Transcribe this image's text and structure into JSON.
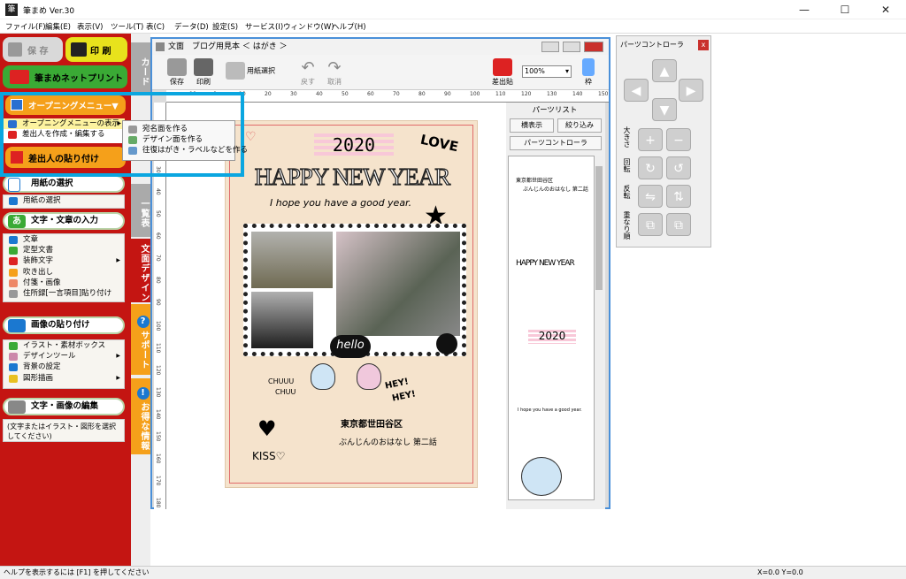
{
  "app": {
    "title": "筆まめ Ver.30",
    "icon": "筆"
  },
  "window_controls": {
    "minimize": "—",
    "maximize": "☐",
    "close": "✕"
  },
  "menubar": [
    "ファイル(F)",
    "編集(E)",
    "表示(V)",
    "ツール(T)",
    "表(C)",
    "データ(D)",
    "設定(S)",
    "サービス(I)",
    "ウィンドウ(W)",
    "ヘルプ(H)"
  ],
  "left": {
    "save": "保 存",
    "print": "印 刷",
    "netprint": "筆まめネットプリント",
    "opening": "オープニングメニュー▼",
    "opening_items": [
      "オープニングメニューの表示",
      "差出人を作成・編集する"
    ],
    "sender_paste": "差出人の貼り付け",
    "paper_title": "用紙の選択",
    "paper_items": [
      "用紙の選択"
    ],
    "text_title": "文字・文章の入力",
    "text_items": [
      "文章",
      "定型文書",
      "装飾文字",
      "吹き出し",
      "付箋・画像",
      "住所録[一言項目]貼り付け"
    ],
    "image_title": "画像の貼り付け",
    "image_items": [
      "イラスト・素材ボックス",
      "デザインツール",
      "背景の設定",
      "図形描画"
    ],
    "edit_title": "文字・画像の編集",
    "edit_note": "(文字またはイラスト・図形を選択してください)"
  },
  "submenu": [
    "宛名面を作る",
    "デザイン面を作る",
    "往復はがき・ラベルなどを作る"
  ],
  "vtabs": {
    "card": "カード",
    "list": "一覧表",
    "design": "文面デザイン",
    "support": "サポート",
    "deals": "お得な情報"
  },
  "doc": {
    "title": "文面　ブログ用見本 ＜ はがき ＞",
    "toolbar": {
      "save": "保存",
      "print": "印刷",
      "paper": "用紙選択",
      "undo": "戻す",
      "redo": "取消",
      "sender": "差出貼",
      "zoom": "100%",
      "frame": "枠"
    },
    "ruler_h": [
      "-10",
      "0",
      "10",
      "20",
      "30",
      "40",
      "50",
      "60",
      "70",
      "80",
      "90",
      "100",
      "110",
      "120",
      "130",
      "140",
      "150"
    ],
    "ruler_v": [
      "10",
      "20",
      "30",
      "40",
      "50",
      "60",
      "70",
      "80",
      "90",
      "100",
      "110",
      "120",
      "130",
      "140",
      "150",
      "160",
      "170",
      "180"
    ]
  },
  "card": {
    "year": "2020",
    "love": "LOVE",
    "headline": "HAPPY NEW YEAR",
    "sub": "I hope you have a good year.",
    "hello": "hello",
    "chuuu1": "CHUUU",
    "chuuu2": "CHUU",
    "hey1": "HEY!",
    "hey2": "HEY!",
    "kiss": "KISS♡",
    "address": "東京都世田谷区",
    "story": "ぶんじんのおはなし 第二話"
  },
  "parts": {
    "title": "パーツリスト",
    "show_all": "横表示",
    "filter": "絞り込み",
    "controller": "パーツコントローラ",
    "items": {
      "addr": "東京都世田谷区",
      "story": "ぶんじんのおはなし 第二話",
      "happy": "HAPPY NEW YEAR",
      "year": "2020",
      "hope": "I hope you have a good year."
    }
  },
  "controller": {
    "title": "パーツコントローラ",
    "close": "x",
    "size": "大きさ",
    "rotate": "回転",
    "flip": "反転",
    "order": "重なり順"
  },
  "status": {
    "help": "ヘルプを表示するには [F1] を押してください",
    "coords": "X=0.0 Y=0.0"
  },
  "colors": {
    "accent_red": "#c41512",
    "highlight": "#0aa6e0",
    "orange": "#f5a01a"
  }
}
